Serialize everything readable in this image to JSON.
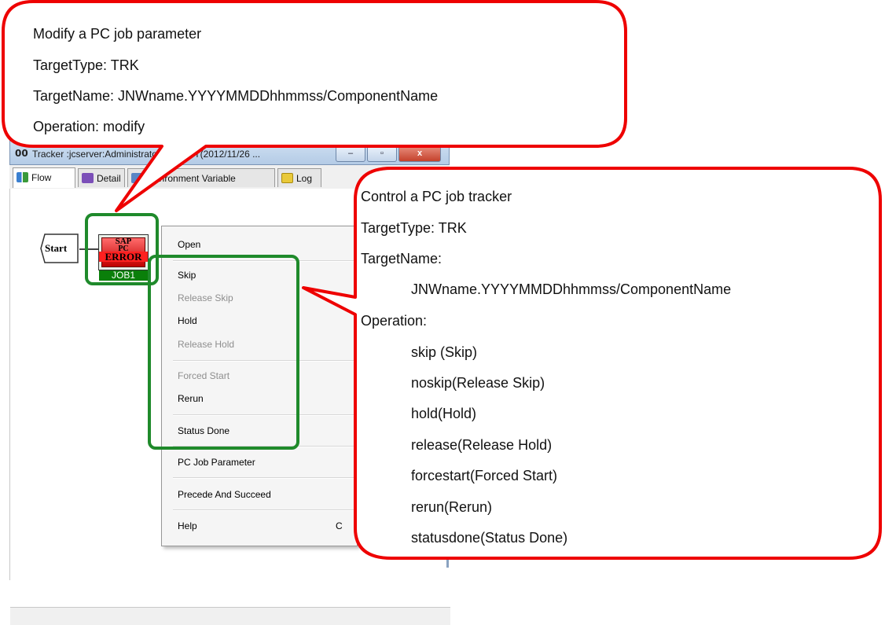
{
  "window": {
    "icon_glyph": "00",
    "title": "Tracker :jcserver:Administrator:PCTEST(2012/11/26 ...",
    "controls": {
      "minimize": "–",
      "maximize": "▫",
      "close": "x"
    }
  },
  "tabs": [
    {
      "label": "Flow",
      "icon": "flow-icon"
    },
    {
      "label": "Detail",
      "icon": "detail-icon"
    },
    {
      "label": "Environment Variable",
      "icon": "environment-icon"
    },
    {
      "label": "Log",
      "icon": "log-icon"
    }
  ],
  "flow": {
    "start_label": "Start",
    "job": {
      "line1": "SAP",
      "line2": "PC",
      "status": "ERROR",
      "name": "JOB1"
    }
  },
  "context_menu": {
    "items": [
      {
        "label": "Open",
        "enabled": true
      },
      {
        "label": "Skip",
        "enabled": true
      },
      {
        "label": "Release Skip",
        "enabled": false
      },
      {
        "label": "Hold",
        "enabled": true
      },
      {
        "label": "Release Hold",
        "enabled": false
      },
      {
        "label": "Forced Start",
        "enabled": false
      },
      {
        "label": "Rerun",
        "enabled": true
      },
      {
        "label": "Status Done",
        "enabled": true
      },
      {
        "label": "PC Job Parameter",
        "enabled": true
      },
      {
        "label": "Precede And Succeed",
        "enabled": true
      },
      {
        "label": "Help",
        "enabled": true
      }
    ],
    "help_shortcut_fragment": "C"
  },
  "callout_parameter": {
    "lines": [
      "Modify a PC job parameter",
      "TargetType: TRK",
      "TargetName: JNWname.YYYYMMDDhhmmss/ComponentName",
      "Operation: modify"
    ]
  },
  "callout_tracker": {
    "heading": "Control a PC job tracker",
    "target_type": "TargetType: TRK",
    "target_name_label": "TargetName:",
    "target_name_value": "JNWname.YYYYMMDDhhmmss/ComponentName",
    "operation_label": "Operation:",
    "operations": [
      "skip (Skip)",
      "noskip(Release Skip)",
      "hold(Hold)",
      "release(Release Hold)",
      "forcestart(Forced Start)",
      "rerun(Rerun)",
      "statusdone(Status Done)"
    ]
  },
  "colors": {
    "callout_border": "#ee0000",
    "highlight_border": "#1f8a2b",
    "job_error": "#ff2020"
  }
}
